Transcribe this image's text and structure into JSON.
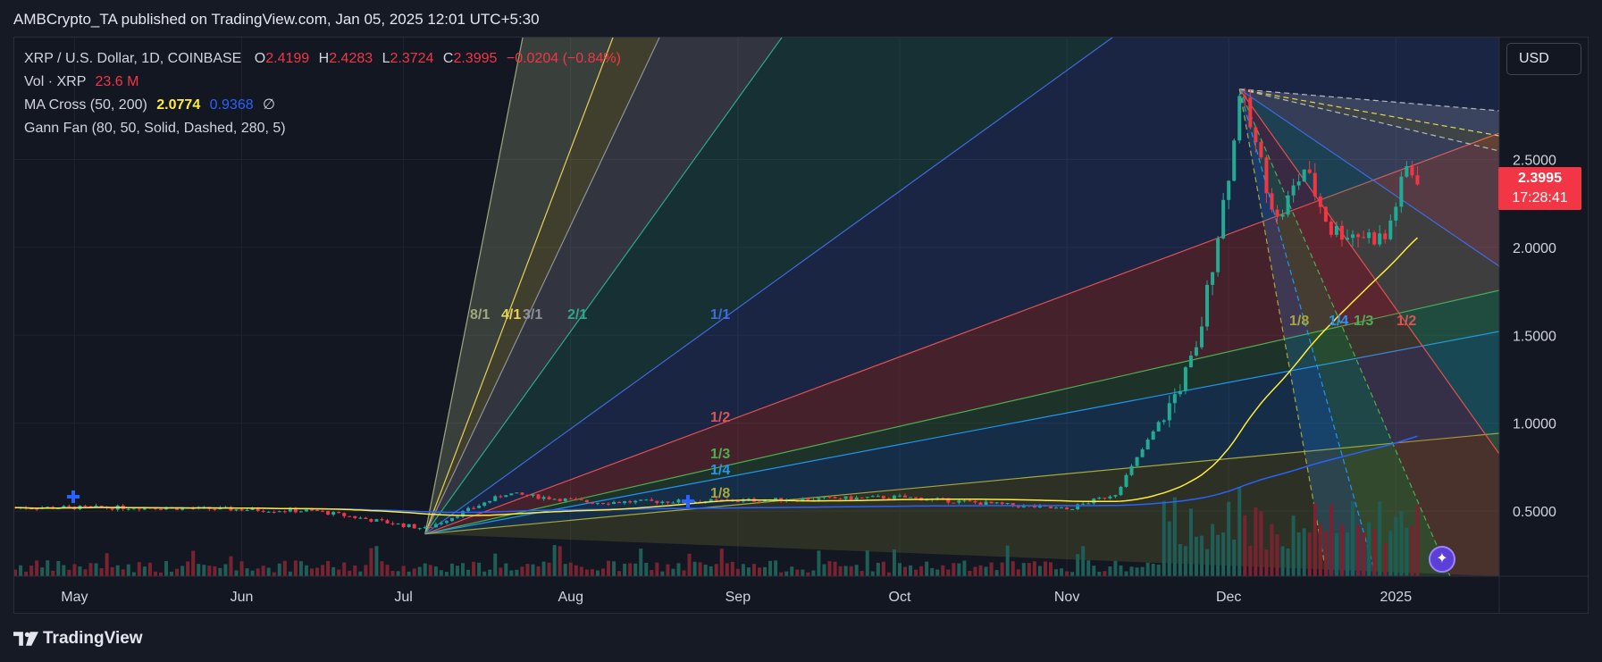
{
  "header": {
    "text": "AMBCrypto_TA published on TradingView.com, Jan 05, 2025 12:01 UTC+5:30"
  },
  "legend": {
    "symbol": "XRP / U.S. Dollar, 1D, COINBASE",
    "o_label": "O",
    "o_value": "2.4199",
    "h_label": "H",
    "h_value": "2.4283",
    "l_label": "L",
    "l_value": "2.3724",
    "c_label": "C",
    "c_value": "2.3995",
    "change": "−0.0204 (−0.84%)",
    "vol_label": "Vol · XRP",
    "vol_value": "23.6 M",
    "ma_label": "MA Cross (50, 200)",
    "ma_fast": "2.0774",
    "ma_slow": "0.9368",
    "ma_extra": "∅",
    "gann_label": "Gann Fan (80, 50, Solid, Dashed, 280, 5)"
  },
  "currency_button": "USD",
  "price_tag": {
    "price": "2.3995",
    "countdown": "17:28:41"
  },
  "footer": {
    "brand": "TradingView"
  },
  "colors": {
    "up": "#22ab94",
    "down": "#f23645",
    "ma_fast": "#ffeb3b",
    "ma_slow": "#2962ff",
    "volume_up": "#1e5e57",
    "volume_down": "#7a2330"
  },
  "chart_data": {
    "type": "candlestick",
    "title": "XRP / U.S. Dollar, 1D, COINBASE",
    "x_ticks": [
      "May",
      "Jun",
      "Jul",
      "Aug",
      "Sep",
      "Oct",
      "Nov",
      "Dec",
      "2025"
    ],
    "y_ticks": [
      "2.5000",
      "2.0000",
      "1.5000",
      "1.0000",
      "0.5000"
    ],
    "y_tick_values": [
      2.5,
      2.0,
      1.5,
      1.0,
      0.5
    ],
    "ylim": [
      0.1,
      3.2
    ],
    "last_price": 2.3995,
    "price_path_approx": [
      {
        "date": "2024-04-20",
        "price": 0.52
      },
      {
        "date": "2024-05-15",
        "price": 0.52
      },
      {
        "date": "2024-06-15",
        "price": 0.5
      },
      {
        "date": "2024-07-05",
        "price": 0.4
      },
      {
        "date": "2024-07-20",
        "price": 0.6
      },
      {
        "date": "2024-08-05",
        "price": 0.55
      },
      {
        "date": "2024-09-01",
        "price": 0.56
      },
      {
        "date": "2024-10-01",
        "price": 0.58
      },
      {
        "date": "2024-11-01",
        "price": 0.51
      },
      {
        "date": "2024-11-10",
        "price": 0.6
      },
      {
        "date": "2024-11-20",
        "price": 1.1
      },
      {
        "date": "2024-11-25",
        "price": 1.4
      },
      {
        "date": "2024-12-02",
        "price": 2.6
      },
      {
        "date": "2024-12-03",
        "price": 2.9
      },
      {
        "date": "2024-12-10",
        "price": 2.15
      },
      {
        "date": "2024-12-15",
        "price": 2.45
      },
      {
        "date": "2024-12-20",
        "price": 2.1
      },
      {
        "date": "2024-12-30",
        "price": 2.05
      },
      {
        "date": "2025-01-03",
        "price": 2.45
      },
      {
        "date": "2025-01-05",
        "price": 2.4
      }
    ],
    "ma_fast_label": "MA 50",
    "ma_slow_label": "MA 200",
    "gann_fan_upper": {
      "origin": {
        "date": "2024-07-05",
        "price": 0.37
      },
      "labels": [
        "8/1",
        "4/1",
        "3/1",
        "2/1",
        "1/1",
        "1/2",
        "1/3",
        "1/4",
        "1/8"
      ]
    },
    "gann_fan_lower": {
      "origin": {
        "date": "2024-12-03",
        "price": 2.9
      },
      "labels": [
        "1/8",
        "1/4",
        "1/3",
        "1/2"
      ]
    },
    "grid": true,
    "legend_position": "top-left"
  }
}
